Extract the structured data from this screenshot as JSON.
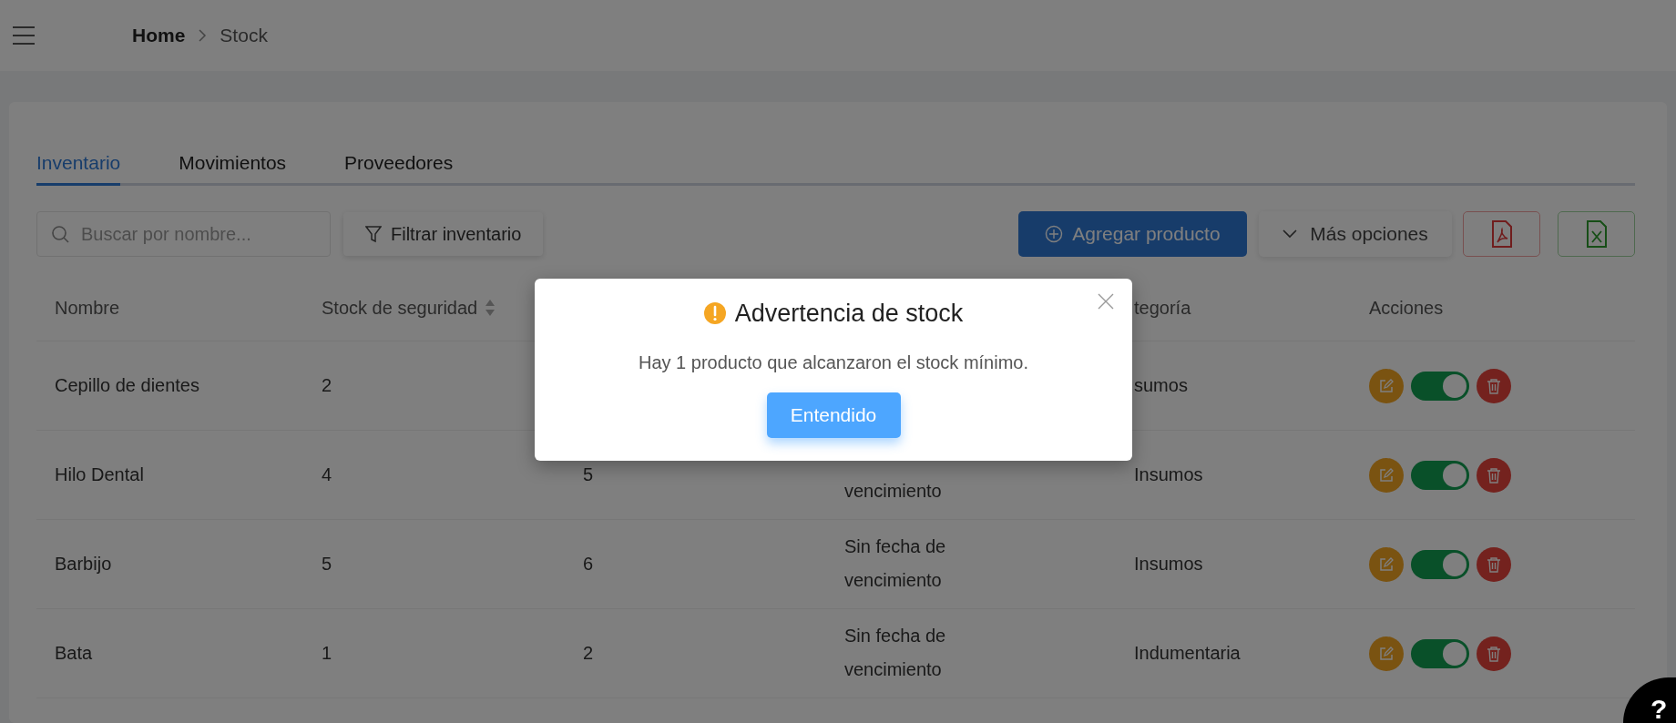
{
  "header": {
    "breadcrumb": [
      {
        "label": "Home",
        "current": false
      },
      {
        "label": "Stock",
        "current": true
      }
    ]
  },
  "tabs": [
    {
      "label": "Inventario",
      "selected": true
    },
    {
      "label": "Movimientos",
      "selected": false
    },
    {
      "label": "Proveedores",
      "selected": false
    }
  ],
  "toolbar": {
    "search": {
      "placeholder": "Buscar por nombre..."
    },
    "filter_button": "Filtrar inventario",
    "add_button": "Agregar producto",
    "more_button": "Más opciones"
  },
  "table": {
    "columns": [
      {
        "label": "Nombre",
        "sortable": false
      },
      {
        "label": "Stock de seguridad",
        "sortable": true
      },
      {
        "label": "tegoría",
        "sortable": false
      },
      {
        "label": "Acciones",
        "sortable": false
      }
    ],
    "rows": [
      {
        "name": "Cepillo de dientes",
        "safety_stock": "2",
        "category": "sumos",
        "active": true
      },
      {
        "name": "Hilo Dental",
        "safety_stock": "4",
        "column_3": "5",
        "column_4": "vencimiento",
        "category": "Insumos",
        "active": true
      },
      {
        "name": "Barbijo",
        "safety_stock": "5",
        "column_3": "6",
        "column_4": "Sin fecha de vencimiento",
        "category": "Insumos",
        "active": true
      },
      {
        "name": "Bata",
        "safety_stock": "1",
        "column_3": "2",
        "column_4": "Sin fecha de vencimiento",
        "category": "Indumentaria",
        "active": true
      }
    ]
  },
  "modal": {
    "title": "Advertencia de stock",
    "message": "Hay 1 producto que alcanzaron el stock mínimo.",
    "button": "Entendido"
  },
  "help_button": "?"
}
